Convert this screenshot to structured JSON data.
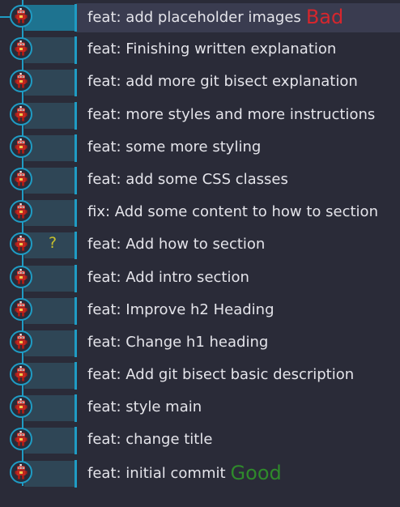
{
  "colors": {
    "background": "#2a2b38",
    "graph_line": "#1f9cc4",
    "row_band": "#2f4656",
    "selected_band": "#1e7390",
    "selected_row": "#3a3c50",
    "text": "#e4e4ea",
    "bad_tag": "#d6262d",
    "good_tag": "#2f8a2b",
    "question_mark": "#c7c02c"
  },
  "commits": [
    {
      "message": "feat: add placeholder images",
      "tag": "Bad",
      "tag_type": "bad",
      "mark": "",
      "selected": true
    },
    {
      "message": "feat: Finishing written explanation",
      "tag": "",
      "tag_type": "",
      "mark": "",
      "selected": false
    },
    {
      "message": "feat: add more git bisect explanation",
      "tag": "",
      "tag_type": "",
      "mark": "",
      "selected": false
    },
    {
      "message": "feat: more styles and more instructions",
      "tag": "",
      "tag_type": "",
      "mark": "",
      "selected": false
    },
    {
      "message": "feat: some more styling",
      "tag": "",
      "tag_type": "",
      "mark": "",
      "selected": false
    },
    {
      "message": "feat: add some CSS classes",
      "tag": "",
      "tag_type": "",
      "mark": "",
      "selected": false
    },
    {
      "message": "fix: Add some content to how to section",
      "tag": "",
      "tag_type": "",
      "mark": "",
      "selected": false
    },
    {
      "message": "feat: Add how to section",
      "tag": "",
      "tag_type": "",
      "mark": "?",
      "selected": false
    },
    {
      "message": "feat: Add intro section",
      "tag": "",
      "tag_type": "",
      "mark": "",
      "selected": false
    },
    {
      "message": "feat: Improve h2 Heading",
      "tag": "",
      "tag_type": "",
      "mark": "",
      "selected": false
    },
    {
      "message": "feat: Change h1 heading",
      "tag": "",
      "tag_type": "",
      "mark": "",
      "selected": false
    },
    {
      "message": "feat: Add git bisect basic description",
      "tag": "",
      "tag_type": "",
      "mark": "",
      "selected": false
    },
    {
      "message": "feat: style main",
      "tag": "",
      "tag_type": "",
      "mark": "",
      "selected": false
    },
    {
      "message": "feat: change title",
      "tag": "",
      "tag_type": "",
      "mark": "",
      "selected": false
    },
    {
      "message": "feat: initial commit",
      "tag": "Good",
      "tag_type": "good",
      "mark": "",
      "selected": false
    }
  ],
  "avatar_icon": "red-robot-avatar-icon"
}
